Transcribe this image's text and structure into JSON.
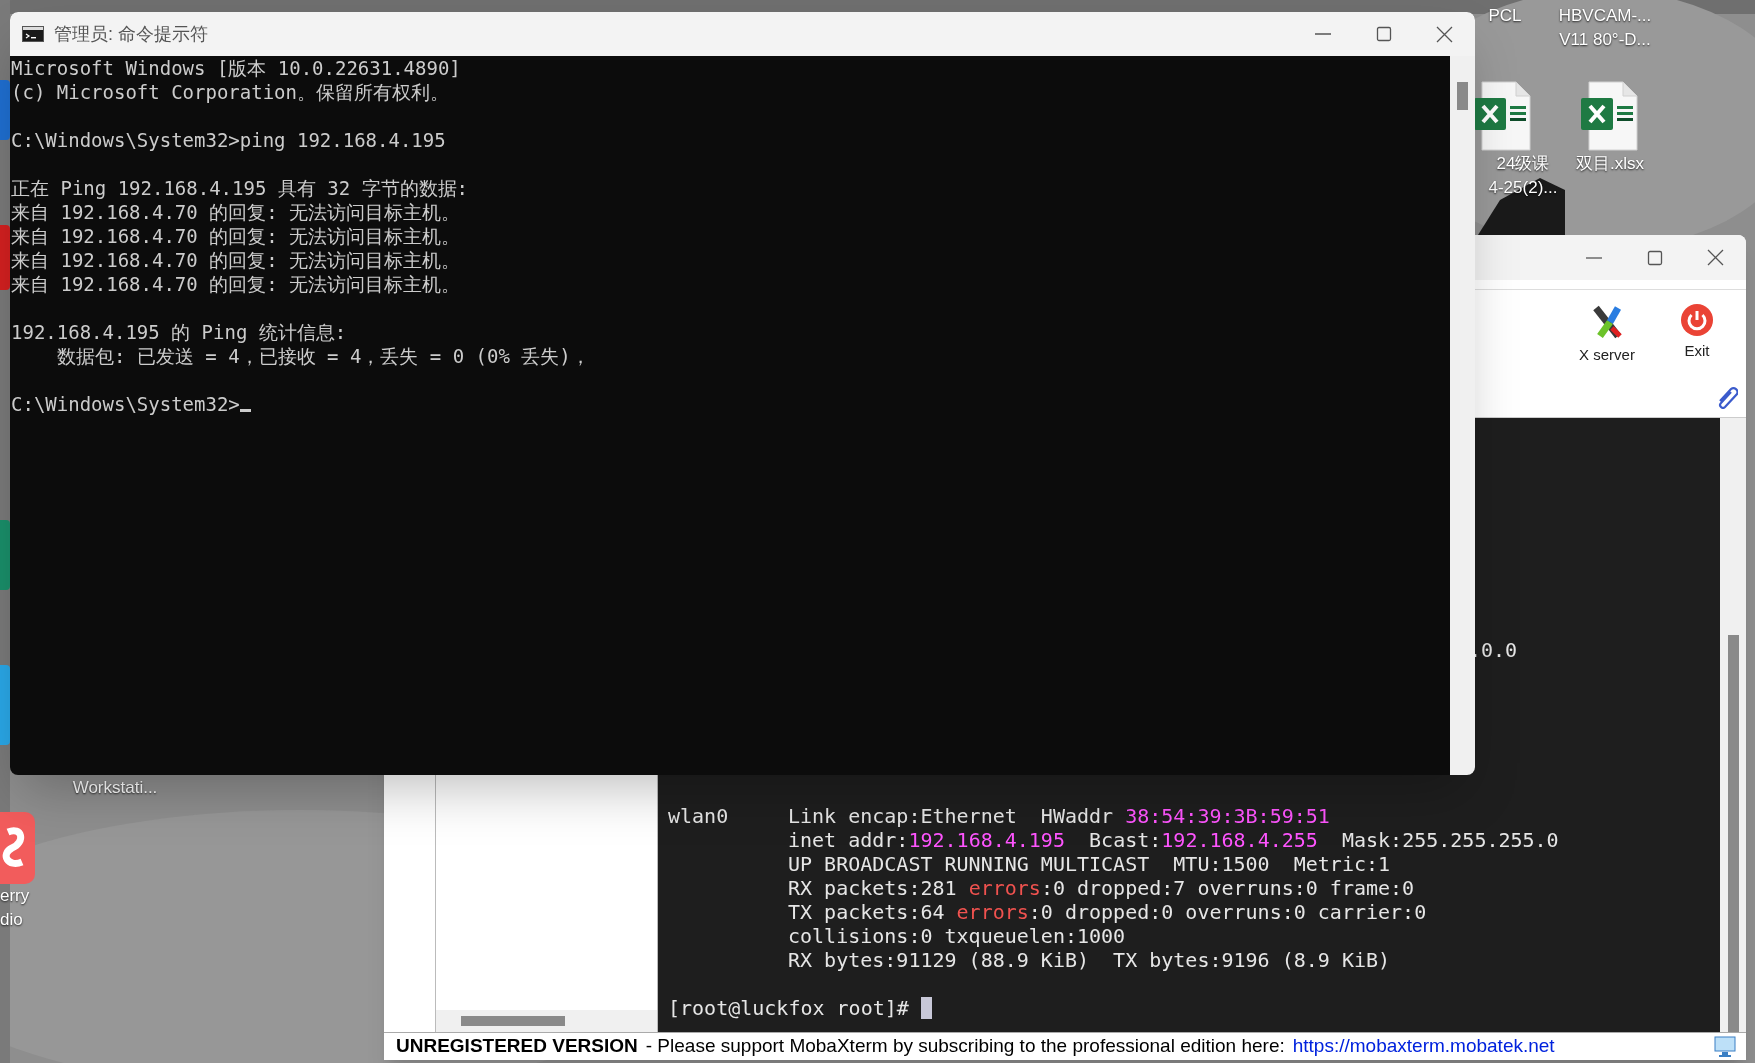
{
  "desktop": {
    "icons": [
      {
        "kind": "label",
        "label": "PCL"
      },
      {
        "kind": "label",
        "label": "HBVCAM-...\nV11 80°-D..."
      },
      {
        "kind": "excel",
        "label": "24级课\n4-25(2)..."
      },
      {
        "kind": "excel",
        "label": "双目.xlsx"
      },
      {
        "kind": "label",
        "label": "Workstati..."
      },
      {
        "kind": "app",
        "label": "erry\ndio"
      }
    ]
  },
  "mobaxterm": {
    "toolbar": [
      {
        "kind": "xserver",
        "label": "X server"
      },
      {
        "kind": "exit",
        "label": "Exit"
      }
    ],
    "terminal": {
      "partial_line": ".0.0",
      "interface": "wlan0",
      "lines": [
        [
          {
            "kind": "plain",
            "text": "Link encap:Ethernet  HWaddr "
          },
          {
            "kind": "address",
            "text": "38:54:39:3B:59:51"
          }
        ],
        [
          {
            "kind": "plain",
            "text": "inet addr:"
          },
          {
            "kind": "address",
            "text": "192.168.4.195"
          },
          {
            "kind": "plain",
            "text": "  Bcast:"
          },
          {
            "kind": "address",
            "text": "192.168.4.255"
          },
          {
            "kind": "plain",
            "text": "  Mask:255.255.255.0"
          }
        ],
        [
          {
            "kind": "plain",
            "text": "UP BROADCAST RUNNING MULTICAST  MTU:1500  Metric:1"
          }
        ],
        [
          {
            "kind": "plain",
            "text": "RX packets:281 "
          },
          {
            "kind": "error",
            "text": "errors"
          },
          {
            "kind": "plain",
            "text": ":0 dropped:7 overruns:0 frame:0"
          }
        ],
        [
          {
            "kind": "plain",
            "text": "TX packets:64 "
          },
          {
            "kind": "error",
            "text": "errors"
          },
          {
            "kind": "plain",
            "text": ":0 dropped:0 overruns:0 carrier:0"
          }
        ],
        [
          {
            "kind": "plain",
            "text": "collisions:0 txqueuelen:1000"
          }
        ],
        [
          {
            "kind": "plain",
            "text": "RX bytes:91129 (88.9 KiB)  TX bytes:9196 (8.9 KiB)"
          }
        ]
      ],
      "prompt": "[root@luckfox root]#"
    },
    "status_bar": {
      "notice": "UNREGISTERED VERSION",
      "message": "-  Please support MobaXterm by subscribing to the professional edition here:",
      "link": "https://mobaxterm.mobatek.net"
    }
  },
  "cmd_window": {
    "title": "管理员: 命令提示符",
    "blocks": [
      {
        "lines": [
          {
            "text": "Microsoft Windows [版本 10.0.22631.4890]",
            "indent": false
          },
          {
            "text": "(c) Microsoft Corporation。保留所有权利。",
            "indent": false
          }
        ]
      },
      {
        "lines": [
          {
            "text": "C:\\Windows\\System32>ping 192.168.4.195",
            "indent": false
          }
        ]
      },
      {
        "lines": [
          {
            "text": "正在 Ping 192.168.4.195 具有 32 字节的数据:",
            "indent": false
          },
          {
            "text": "来自 192.168.4.70 的回复: 无法访问目标主机。",
            "indent": false
          },
          {
            "text": "来自 192.168.4.70 的回复: 无法访问目标主机。",
            "indent": false
          },
          {
            "text": "来自 192.168.4.70 的回复: 无法访问目标主机。",
            "indent": false
          },
          {
            "text": "来自 192.168.4.70 的回复: 无法访问目标主机。",
            "indent": false
          }
        ]
      },
      {
        "lines": [
          {
            "text": "192.168.4.195 的 Ping 统计信息:",
            "indent": false
          },
          {
            "text": "数据包: 已发送 = 4，已接收 = 4，丢失 = 0 (0% 丢失)，",
            "indent": true
          }
        ]
      },
      {
        "lines": [
          {
            "text": "C:\\Windows\\System32>",
            "indent": false
          }
        ]
      }
    ]
  }
}
